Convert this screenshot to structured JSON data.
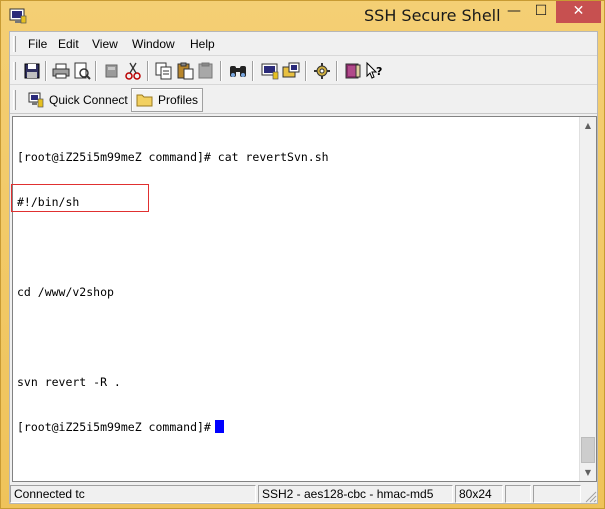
{
  "window": {
    "title": "SSH Secure Shell",
    "controls": {
      "minimize": "—",
      "maximize": "☐",
      "close": "✕"
    }
  },
  "menu": {
    "items": [
      {
        "label": "File"
      },
      {
        "label": "Edit"
      },
      {
        "label": "View"
      },
      {
        "label": "Window"
      },
      {
        "label": "Help"
      }
    ]
  },
  "toolbar": {
    "buttons": [
      {
        "icon": "save-icon"
      },
      {
        "icon": "print-icon"
      },
      {
        "icon": "print-preview-icon"
      },
      {
        "icon": "disconnect-icon"
      },
      {
        "icon": "cut-icon"
      },
      {
        "icon": "copy-icon"
      },
      {
        "icon": "paste-icon"
      },
      {
        "icon": "paste-special-icon"
      },
      {
        "icon": "find-icon"
      },
      {
        "icon": "new-terminal-icon"
      },
      {
        "icon": "new-file-transfer-icon"
      },
      {
        "icon": "settings-icon"
      },
      {
        "icon": "help-topics-icon"
      },
      {
        "icon": "context-help-icon"
      }
    ]
  },
  "quickbar": {
    "quick_connect": "Quick Connect",
    "profiles": "Profiles"
  },
  "terminal": {
    "lines": [
      "[root@iZ25i5m99meZ command]# cat revertSvn.sh",
      "#!/bin/sh",
      "",
      "cd /www/v2shop",
      "",
      "svn revert -R .",
      "[root@iZ25i5m99meZ command]#"
    ],
    "cursor_color": "#0000ff",
    "highlighted_line": "svn revert -R ."
  },
  "status": {
    "connection": "Connected tc",
    "cipher": "SSH2 - aes128-cbc - hmac-md5",
    "size": "80x24"
  },
  "colors": {
    "title_bar": "#f0c660",
    "close_button": "#c75050",
    "highlight_box": "#e03030"
  }
}
